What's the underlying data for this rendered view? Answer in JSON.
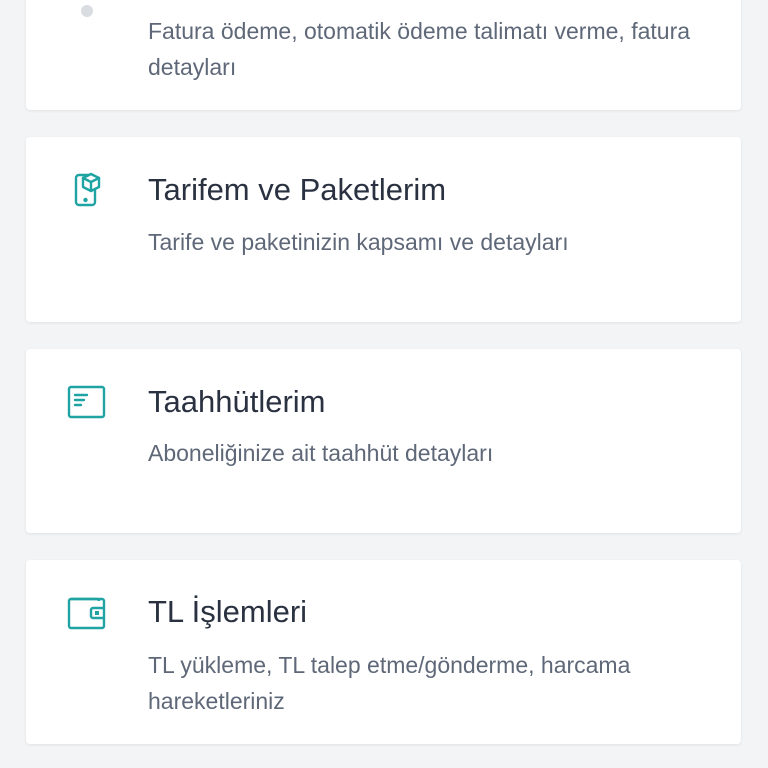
{
  "accent_color": "#1fa3a3",
  "cards": [
    {
      "icon": "bill-icon",
      "title": "",
      "description": "Fatura ödeme, otomatik ödeme talimatı verme, fatura detayları"
    },
    {
      "icon": "package-phone-icon",
      "title": "Tarifem ve Paketlerim",
      "description": "Tarife ve paketinizin kapsamı ve detayları"
    },
    {
      "icon": "contract-icon",
      "title": "Taahhütlerim",
      "description": "Aboneliğinize ait taahhüt detayları"
    },
    {
      "icon": "wallet-icon",
      "title": "TL İşlemleri",
      "description": "TL yükleme, TL talep etme/gönderme, harcama hareketleriniz"
    }
  ]
}
